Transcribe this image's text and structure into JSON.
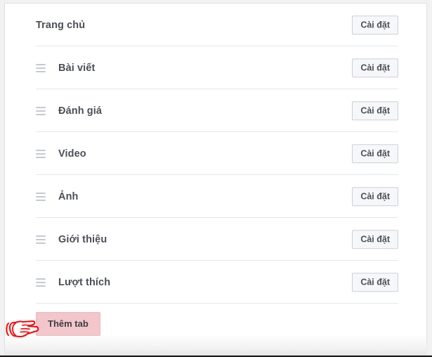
{
  "panel": {
    "name": "page-tabs-settings-panel",
    "accent_color": "#f2c6ca",
    "border_color": "#dddfe2",
    "separator_color": "#e4e6e9"
  },
  "tabs": [
    {
      "label": "Trang chủ",
      "draggable": false,
      "settings_label": "Cài đặt"
    },
    {
      "label": "Bài viết",
      "draggable": true,
      "settings_label": "Cài đặt"
    },
    {
      "label": "Đánh giá",
      "draggable": true,
      "settings_label": "Cài đặt"
    },
    {
      "label": "Video",
      "draggable": true,
      "settings_label": "Cài đặt"
    },
    {
      "label": "Ảnh",
      "draggable": true,
      "settings_label": "Cài đặt"
    },
    {
      "label": "Giới thiệu",
      "draggable": true,
      "settings_label": "Cài đặt"
    },
    {
      "label": "Lượt thích",
      "draggable": true,
      "settings_label": "Cài đặt"
    }
  ],
  "add_tab": {
    "label": "Thêm tab",
    "background_color": "#f2c6ca",
    "text_color": "#3b3e43"
  },
  "annotation": {
    "icon": "pointing-hand-cursor",
    "color": "#ff0000",
    "direction": "right"
  },
  "icons": {
    "drag_handle": "drag-handle-icon"
  }
}
